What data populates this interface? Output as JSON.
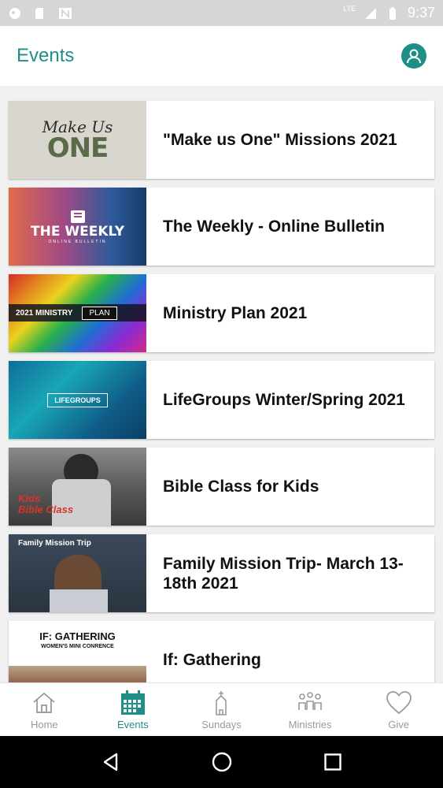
{
  "status_bar": {
    "time": "9:37",
    "network": "LTE",
    "icons": [
      "notification-icon",
      "sd-card-icon",
      "n-icon",
      "signal-icon",
      "battery-icon"
    ]
  },
  "header": {
    "title": "Events",
    "profile_icon": "profile-icon"
  },
  "events": [
    {
      "title": "\"Make us One\" Missions 2021",
      "thumb_line1": "Make Us",
      "thumb_line2": "ONE"
    },
    {
      "title": "The Weekly - Online Bulletin",
      "thumb_line1": "THE WEEKLY",
      "thumb_line2": "ONLINE BULLETIN"
    },
    {
      "title": "Ministry Plan 2021",
      "thumb_line1": "2021 MINISTRY",
      "thumb_line2": "PLAN"
    },
    {
      "title": "LifeGroups Winter/Spring 2021",
      "thumb_line1": "LIFEGROUPS",
      "thumb_line2": ""
    },
    {
      "title": "Bible Class for Kids",
      "thumb_line1": "Kids",
      "thumb_line2": "Bible Class"
    },
    {
      "title": "Family Mission Trip- March 13-18th 2021",
      "thumb_line1": "Family Mission Trip",
      "thumb_line2": ""
    },
    {
      "title": "If: Gathering",
      "thumb_line1": "IF: GATHERING",
      "thumb_line2": "WOMEN'S MINI CONRENCE"
    }
  ],
  "bottom_nav": [
    {
      "label": "Home",
      "icon": "home-icon",
      "active": false
    },
    {
      "label": "Events",
      "icon": "calendar-icon",
      "active": true
    },
    {
      "label": "Sundays",
      "icon": "church-icon",
      "active": false
    },
    {
      "label": "Ministries",
      "icon": "people-icon",
      "active": false
    },
    {
      "label": "Give",
      "icon": "heart-icon",
      "active": false
    }
  ],
  "colors": {
    "accent": "#1e8f86",
    "nav_inactive": "#9a9a9a",
    "status_bar": "#d6d6d6"
  }
}
